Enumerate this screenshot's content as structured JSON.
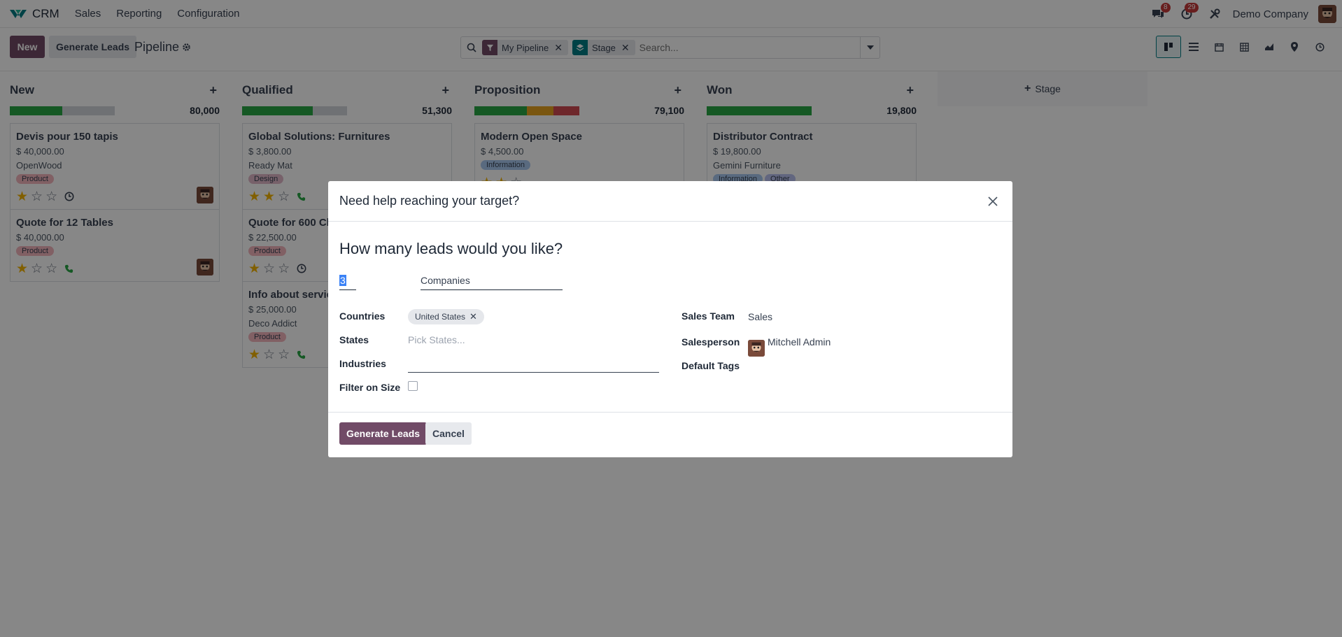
{
  "topbar": {
    "app_name": "CRM",
    "menu": [
      "Sales",
      "Reporting",
      "Configuration"
    ],
    "messages_badge": "8",
    "activities_badge": "29",
    "company": "Demo Company"
  },
  "control": {
    "new_label": "New",
    "generate_label": "Generate Leads",
    "title": "Pipeline",
    "facets": [
      {
        "label": "My Pipeline",
        "icon": "filter-icon"
      },
      {
        "label": "Stage",
        "icon": "layers-icon"
      }
    ],
    "search_placeholder": "Search..."
  },
  "columns": [
    {
      "title": "New",
      "total": "80,000",
      "progress": [
        {
          "color": "#28a745",
          "fraction": 0.5
        }
      ],
      "cards": [
        {
          "title": "Devis pour 150 tapis",
          "amount": "$ 40,000.00",
          "customer": "OpenWood",
          "tags": [
            {
              "label": "Product",
              "type": "product"
            }
          ],
          "stars": 1,
          "activity": "clock-icon",
          "avatar": true
        },
        {
          "title": "Quote for 12 Tables",
          "amount": "$ 40,000.00",
          "customer": "",
          "tags": [
            {
              "label": "Product",
              "type": "product"
            }
          ],
          "stars": 1,
          "activity": "phone-icon",
          "avatar": true
        }
      ]
    },
    {
      "title": "Qualified",
      "total": "51,300",
      "progress": [
        {
          "color": "#28a745",
          "fraction": 0.67
        }
      ],
      "cards": [
        {
          "title": "Global Solutions: Furnitures",
          "amount": "$ 3,800.00",
          "customer": "Ready Mat",
          "tags": [
            {
              "label": "Design",
              "type": "design"
            }
          ],
          "stars": 2,
          "activity": "phone-icon",
          "avatar": false
        },
        {
          "title": "Quote for 600 Ch",
          "amount": "$ 22,500.00",
          "customer": "",
          "tags": [
            {
              "label": "Product",
              "type": "product"
            }
          ],
          "stars": 1,
          "activity": "clock-icon",
          "avatar": false
        },
        {
          "title": "Info about servic",
          "amount": "$ 25,000.00",
          "customer": "Deco Addict",
          "tags": [
            {
              "label": "Product",
              "type": "product"
            }
          ],
          "stars": 1,
          "activity": "phone-icon",
          "avatar": false
        }
      ]
    },
    {
      "title": "Proposition",
      "total": "79,100",
      "progress": [
        {
          "color": "#28a745",
          "fraction": 0.5
        },
        {
          "color": "#e7a31f",
          "fraction": 0.25
        },
        {
          "color": "#d04a52",
          "fraction": 0.25
        }
      ],
      "cards": [
        {
          "title": "Modern Open Space",
          "amount": "$ 4,500.00",
          "customer": "",
          "tags": [
            {
              "label": "Information",
              "type": "info"
            }
          ],
          "stars": 2,
          "activity": "",
          "avatar": false
        }
      ]
    },
    {
      "title": "Won",
      "total": "19,800",
      "progress": [
        {
          "color": "#28a745",
          "fraction": 1.0
        }
      ],
      "cards": [
        {
          "title": "Distributor Contract",
          "amount": "$ 19,800.00",
          "customer": "Gemini Furniture",
          "tags": [
            {
              "label": "Information",
              "type": "info"
            },
            {
              "label": "Other",
              "type": "other"
            }
          ],
          "stars": 0,
          "activity": "",
          "avatar": false
        }
      ]
    }
  ],
  "add_stage_label": "Stage",
  "modal": {
    "title": "Need help reaching your target?",
    "question": "How many leads would you like?",
    "count": "3",
    "type_value": "Companies",
    "countries_label": "Countries",
    "country_chip": "United States",
    "states_label": "States",
    "states_placeholder": "Pick States...",
    "industries_label": "Industries",
    "filter_size_label": "Filter on Size",
    "sales_team_label": "Sales Team",
    "sales_team_value": "Sales",
    "salesperson_label": "Salesperson",
    "salesperson_value": "Mitchell Admin",
    "default_tags_label": "Default Tags",
    "generate_label": "Generate Leads",
    "cancel_label": "Cancel"
  }
}
